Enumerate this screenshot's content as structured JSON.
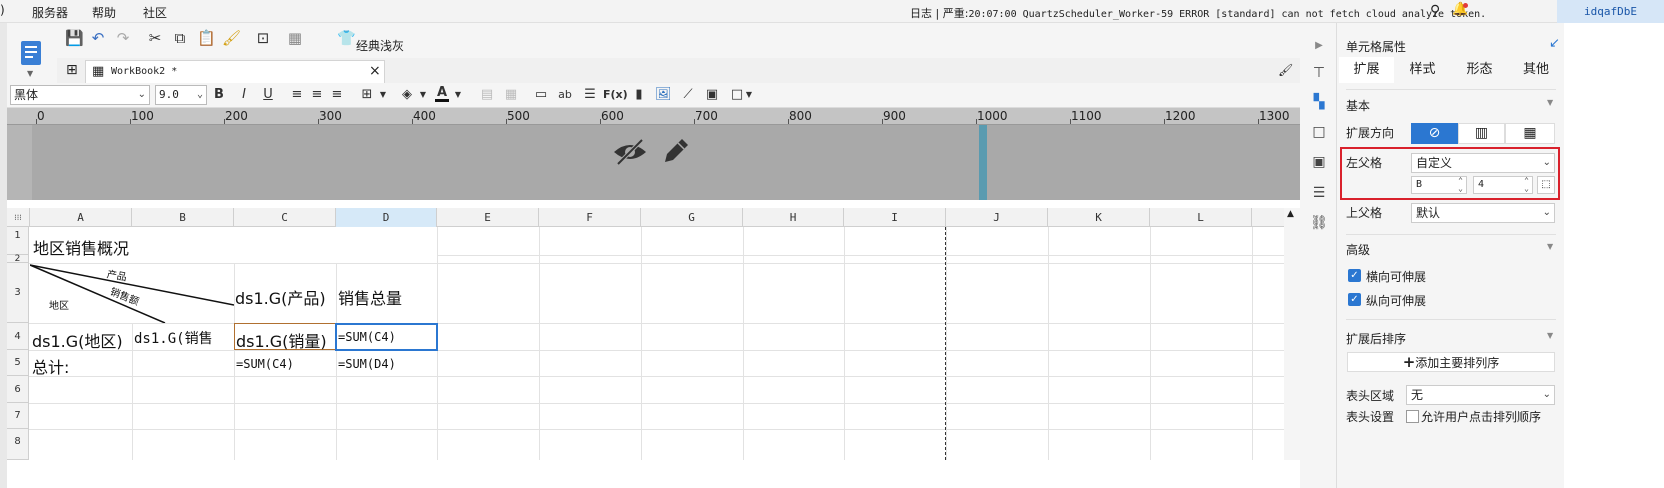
{
  "menubar": {
    "items": [
      "服务器",
      "帮助",
      "社区"
    ],
    "log_label": "日志",
    "log_sep": "|",
    "log_prefix": "严重:",
    "log_text": "20:07:00 QuartzScheduler_Worker-59 ERROR [standard] can not fetch cloud analyze token.",
    "user": "idqafDbE"
  },
  "toolbar": {
    "theme_label": "经典浅灰",
    "font": "黑体",
    "size": "9.0",
    "bold": "B",
    "italic": "I",
    "underline": "U",
    "fx": "F(x)",
    "ab": "ab"
  },
  "tab": {
    "title": "WorkBook2 *",
    "close": "×"
  },
  "ruler": {
    "labels": [
      "0",
      "100",
      "200",
      "300",
      "400",
      "500",
      "600",
      "700",
      "800",
      "900",
      "1000",
      "1100",
      "1200",
      "1300"
    ]
  },
  "grid": {
    "columns": [
      "A",
      "B",
      "C",
      "D",
      "E",
      "F",
      "G",
      "H",
      "I",
      "J",
      "K",
      "L"
    ],
    "rows": [
      "1",
      "2",
      "3",
      "4",
      "5",
      "6",
      "7",
      "8"
    ],
    "cells": {
      "title": "地区销售概况",
      "slash_product": "产品",
      "slash_sales": "销售额",
      "slash_region": "地区",
      "c3": "ds1.G(产品)",
      "d3": "销售总量",
      "a4": "ds1.G(地区)",
      "b4": "ds1.G(销售",
      "c4": "ds1.G(销量)",
      "d4": "=SUM(C4)",
      "a5": "总计:",
      "c5": "=SUM(C4)",
      "d5": "=SUM(D4)"
    }
  },
  "panel": {
    "title": "单元格属性",
    "tabs": [
      "扩展",
      "样式",
      "形态",
      "其他"
    ],
    "basic": "基本",
    "expand_dir": "扩展方向",
    "left_parent": "左父格",
    "left_parent_value": "自定义",
    "left_col": "B",
    "left_row": "4",
    "up_parent": "上父格",
    "up_parent_value": "默认",
    "advanced": "高级",
    "h_expand": "横向可伸展",
    "v_expand": "纵向可伸展",
    "sort_after": "扩展后排序",
    "add_sort": "添加主要排列序",
    "header_area": "表头区域",
    "header_area_value": "无",
    "header_settings": "表头设置",
    "allow_sort": "允许用户点击排列顺序"
  },
  "colors": {
    "accent": "#2b77d1",
    "highlight_border": "#d9212c",
    "selected_col": "#d6e9f8"
  }
}
